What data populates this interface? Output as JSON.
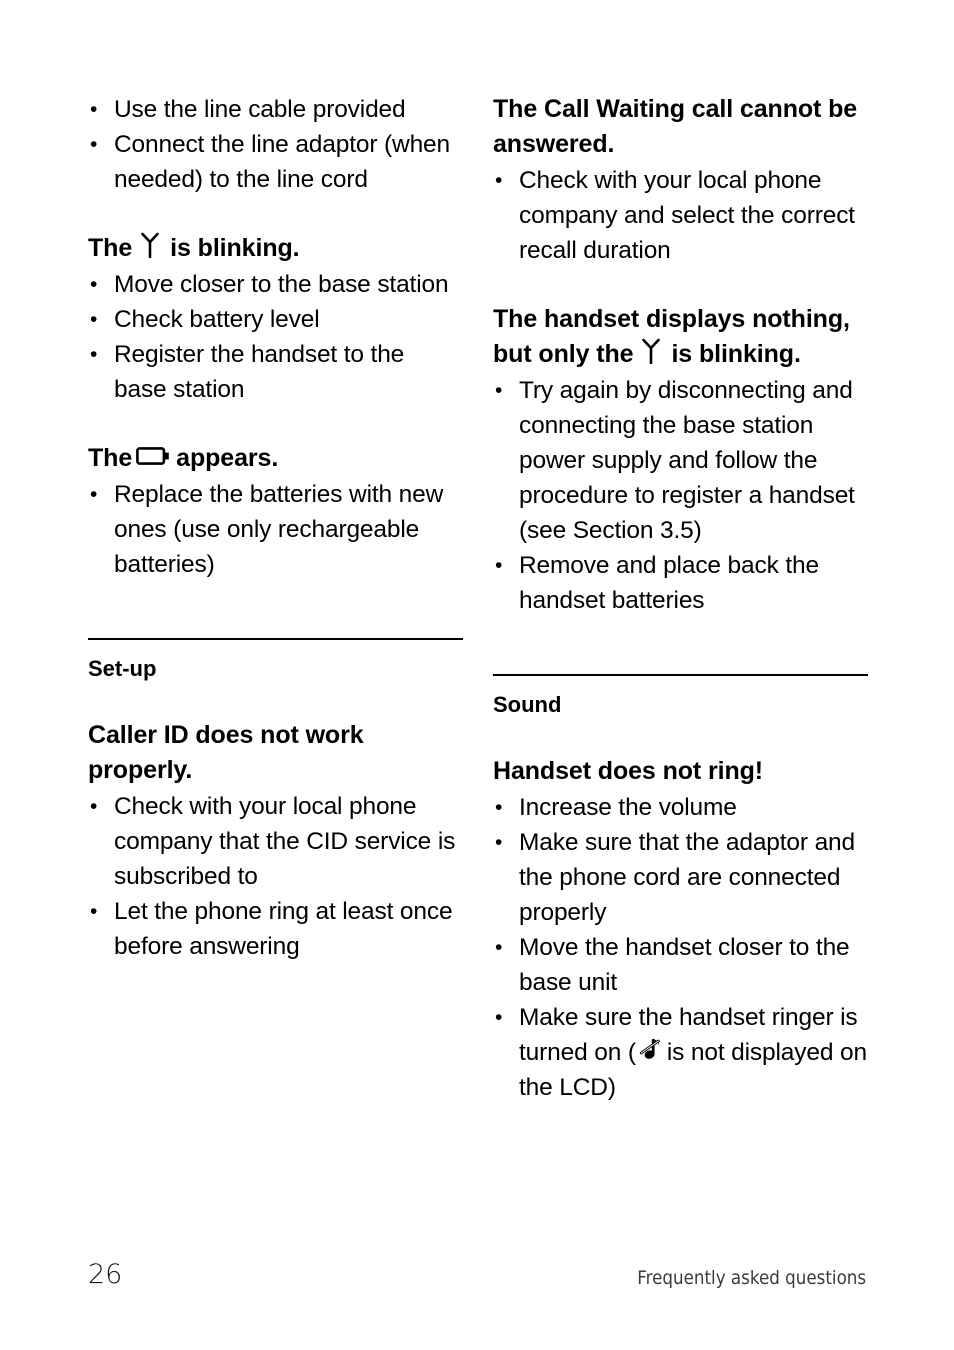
{
  "document": {
    "page_number": "26",
    "footer_label": "Frequently asked questions"
  },
  "icons": {
    "antenna": "antenna-icon",
    "battery_empty": "battery-empty-icon",
    "ringer_off": "ringer-off-icon"
  },
  "left_column": {
    "top_bullets": [
      "Use the line cable provided",
      "Connect the line adaptor (when needed) to the line cord"
    ],
    "block_antenna": {
      "heading_before": "The",
      "heading_after": "is blinking.",
      "bullets": [
        "Move closer to the base station",
        "Check battery level",
        "Register the handset to the base station"
      ]
    },
    "block_battery": {
      "heading_before": "The",
      "heading_after": "appears.",
      "bullets": [
        "Replace the batteries with new ones (use only rechargeable batteries)"
      ]
    },
    "section": {
      "title": "Set-up",
      "heading": "Caller ID does not work properly.",
      "bullets": [
        "Check with your local phone company that the CID service is subscribed to",
        "Let the phone ring at least once before answering"
      ]
    }
  },
  "right_column": {
    "block_call_waiting": {
      "heading": "The Call Waiting call cannot be answered.",
      "bullets": [
        "Check with your local phone company and select the correct recall duration"
      ]
    },
    "block_handset_display": {
      "heading_before": "The handset displays nothing, but only the",
      "heading_after": "is blinking.",
      "bullets": [
        "Try again by disconnecting and connecting the base station power supply and follow the procedure to register a handset (see Section 3.5)",
        "Remove and place back the handset batteries"
      ]
    },
    "section": {
      "title": "Sound",
      "heading": "Handset does not ring!",
      "bullets": [
        "Increase the volume",
        "Make sure that the adaptor and the phone cord are connected properly",
        "Move the handset closer to the base unit"
      ],
      "bullet_ringer_before": "Make sure the handset ringer is turned on (",
      "bullet_ringer_after": "is not displayed on the LCD)"
    }
  }
}
